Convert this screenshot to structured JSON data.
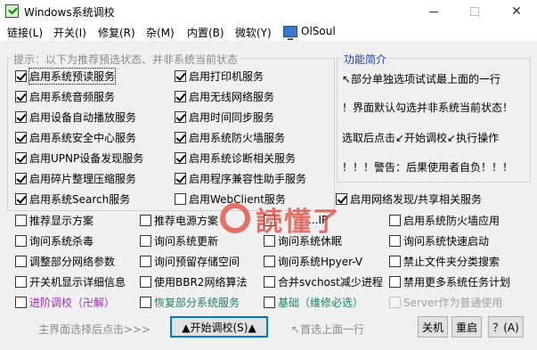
{
  "window": {
    "title": "Windows系统调校"
  },
  "menu": {
    "items": [
      "链接(L)",
      "开关(I)",
      "修复(R)",
      "杂(M)",
      "内置(B)",
      "微软(Y)"
    ],
    "brand": "OlSoul"
  },
  "group": {
    "legend": "提示：以下为推荐预选状态、并非系统当前状态"
  },
  "info": {
    "legend": "功能简介",
    "lines": [
      "↖部分单独选项试试最上面的一行",
      "！界面默认勾选并非系统当前状态！",
      "选取后点击↙开始调校↙执行操作",
      "！！！警告：后果使用者自负！！！"
    ]
  },
  "checkboxes": {
    "c1": {
      "label": "启用系统预读服务",
      "checked": true
    },
    "c2": {
      "label": "启用系统音频服务",
      "checked": true
    },
    "c3": {
      "label": "启用设备自动播放服务",
      "checked": true
    },
    "c4": {
      "label": "启用系统安全中心服务",
      "checked": true
    },
    "c5": {
      "label": "启用UPNP设备发现服务",
      "checked": true
    },
    "c6": {
      "label": "启用碎片整理压缩服务",
      "checked": true
    },
    "c7": {
      "label": "启用系统Search服务",
      "checked": true
    },
    "d1": {
      "label": "启用打印机服务",
      "checked": true
    },
    "d2": {
      "label": "启用无线网络服务",
      "checked": true
    },
    "d3": {
      "label": "启用时间同步服务",
      "checked": true
    },
    "d4": {
      "label": "启用系统防火墙服务",
      "checked": true
    },
    "d5": {
      "label": "启用系统诊断相关服务",
      "checked": true
    },
    "d6": {
      "label": "启用程序兼容性助手服务",
      "checked": true
    },
    "d7": {
      "label": "启用WebClient服务",
      "checked": false
    },
    "e7": {
      "label": "启用网络发现/共享相关服务",
      "checked": true
    },
    "r1a": {
      "label": "推荐显示方案",
      "checked": false
    },
    "r1b": {
      "label": "推荐电源方案",
      "checked": false
    },
    "r1c": {
      "label": "...IP",
      "checked": false
    },
    "r1d": {
      "label": "启用系统防火墙应用",
      "checked": false
    },
    "r2a": {
      "label": "询问系统杀毒",
      "checked": false
    },
    "r2b": {
      "label": "询问系统更新",
      "checked": false
    },
    "r2c": {
      "label": "询问系统休眠",
      "checked": false
    },
    "r2d": {
      "label": "询问系统快速启动",
      "checked": false
    },
    "r3a": {
      "label": "调整部分网络参数",
      "checked": false
    },
    "r3b": {
      "label": "询问预留存储空间",
      "checked": false
    },
    "r3c": {
      "label": "询问系统Hpyer-V",
      "checked": false
    },
    "r3d": {
      "label": "禁止文件夹分类搜索",
      "checked": false
    },
    "r4a": {
      "label": "开关机显示详细信息",
      "checked": false
    },
    "r4b": {
      "label": "使用BBR2网络算法",
      "checked": false
    },
    "r4c": {
      "label": "合并svchost减少进程",
      "checked": false
    },
    "r4d": {
      "label": "禁用更多系统任务计划",
      "checked": false
    },
    "r5a": {
      "label": "进阶调校（卍解）",
      "checked": false
    },
    "r5b": {
      "label": "恢复部分系统服务",
      "checked": false
    },
    "r5c": {
      "label": "基础（维修必选）",
      "checked": false
    },
    "r5d": {
      "label": "Server作为普通使用",
      "checked": false
    }
  },
  "bottom": {
    "hint_left": "主界面选择后点击>>>",
    "start_button": "▲开始调校(S)▲",
    "hint_right": "↖首选上面一行",
    "shutdown_button": "关机",
    "restart_button": "重启",
    "help_button": "？(A)"
  },
  "watermark": {
    "text": "読懂了"
  }
}
